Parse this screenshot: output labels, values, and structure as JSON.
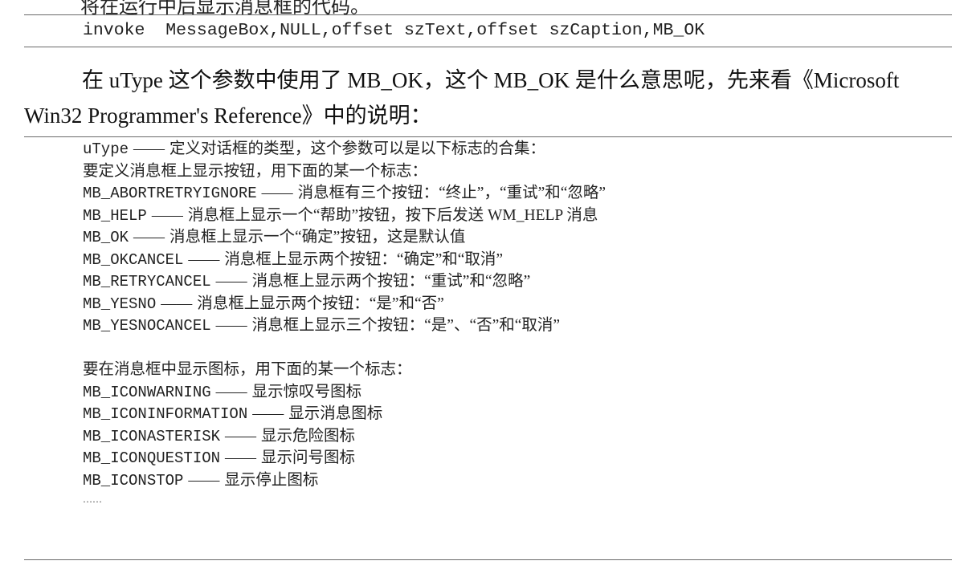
{
  "top_fragment": "将在运行中后显示消息框的代码。",
  "code_line": "invoke  MessageBox,NULL,offset szText,offset szCaption,MB_OK",
  "paragraph": {
    "line1": "在 uType 这个参数中使用了 MB_OK，这个 MB_OK 是什么意思呢，先来看《Microsoft",
    "line2": "Win32 Programmer's Reference》中的说明："
  },
  "dash": "——",
  "reference": {
    "utype": {
      "key": "uType",
      "desc": "定义对话框的类型，这个参数可以是以下标志的合集："
    },
    "buttons_heading": "要定义消息框上显示按钮，用下面的某一个标志：",
    "buttons": [
      {
        "key": "MB_ABORTRETRYIGNORE",
        "desc": "消息框有三个按钮：“终止”，“重试”和“忽略”"
      },
      {
        "key": "MB_HELP",
        "desc": "消息框上显示一个“帮助”按钮，按下后发送 WM_HELP 消息"
      },
      {
        "key": "MB_OK",
        "desc": "消息框上显示一个“确定”按钮，这是默认值"
      },
      {
        "key": "MB_OKCANCEL",
        "desc": "消息框上显示两个按钮：“确定”和“取消”"
      },
      {
        "key": "MB_RETRYCANCEL",
        "desc": "消息框上显示两个按钮：“重试”和“忽略”"
      },
      {
        "key": "MB_YESNO",
        "desc": "消息框上显示两个按钮：“是”和“否”"
      },
      {
        "key": "MB_YESNOCANCEL",
        "desc": "消息框上显示三个按钮：“是”、“否”和“取消”"
      }
    ],
    "icons_heading": "要在消息框中显示图标，用下面的某一个标志：",
    "icons": [
      {
        "key": "MB_ICONWARNING",
        "desc": "显示惊叹号图标"
      },
      {
        "key": "MB_ICONINFORMATION",
        "desc": "显示消息图标"
      },
      {
        "key": "MB_ICONASTERISK",
        "desc": "显示危险图标"
      },
      {
        "key": "MB_ICONQUESTION",
        "desc": "显示问号图标"
      },
      {
        "key": "MB_ICONSTOP",
        "desc": "显示停止图标"
      }
    ],
    "ellipsis": "……"
  }
}
